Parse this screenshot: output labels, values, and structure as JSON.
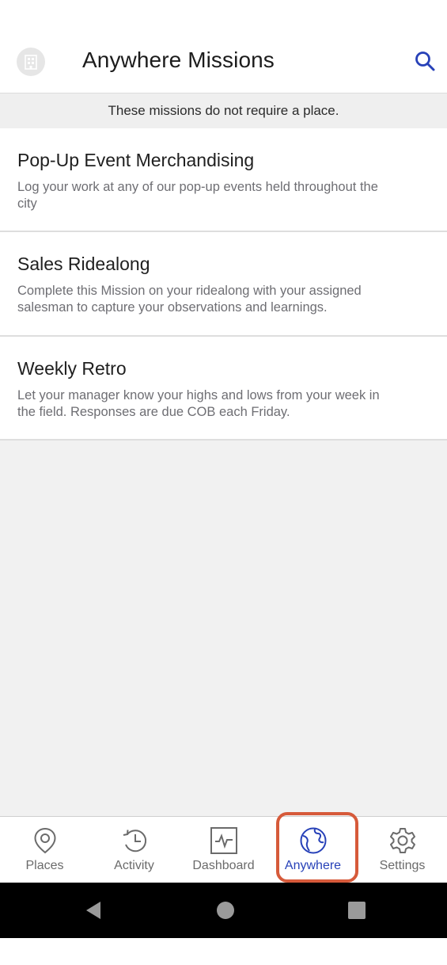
{
  "header": {
    "title": "Anywhere Missions",
    "logo_icon": "building-icon",
    "search_icon": "search-icon"
  },
  "banner": "These missions do not require a place.",
  "missions": [
    {
      "title": "Pop-Up Event Merchandising",
      "description": "Log your work at any of our pop-up events held throughout the city"
    },
    {
      "title": "Sales Ridealong",
      "description": "Complete this Mission on your ridealong with your assigned salesman to capture your observations and learnings."
    },
    {
      "title": "Weekly Retro",
      "description": "Let your manager know your highs and lows from your week in the field. Responses are due COB each Friday."
    }
  ],
  "nav": {
    "items": [
      {
        "label": "Places",
        "icon": "map-pin-icon"
      },
      {
        "label": "Activity",
        "icon": "history-icon"
      },
      {
        "label": "Dashboard",
        "icon": "pulse-icon"
      },
      {
        "label": "Anywhere",
        "icon": "globe-icon",
        "active": true
      },
      {
        "label": "Settings",
        "icon": "gear-icon"
      }
    ]
  },
  "colors": {
    "accent": "#2741b8",
    "highlight": "#d65a3a",
    "inactive": "#6b6b6b",
    "background": "#f1f1f1"
  },
  "system_nav": [
    "back-icon",
    "home-icon",
    "recents-icon"
  ]
}
